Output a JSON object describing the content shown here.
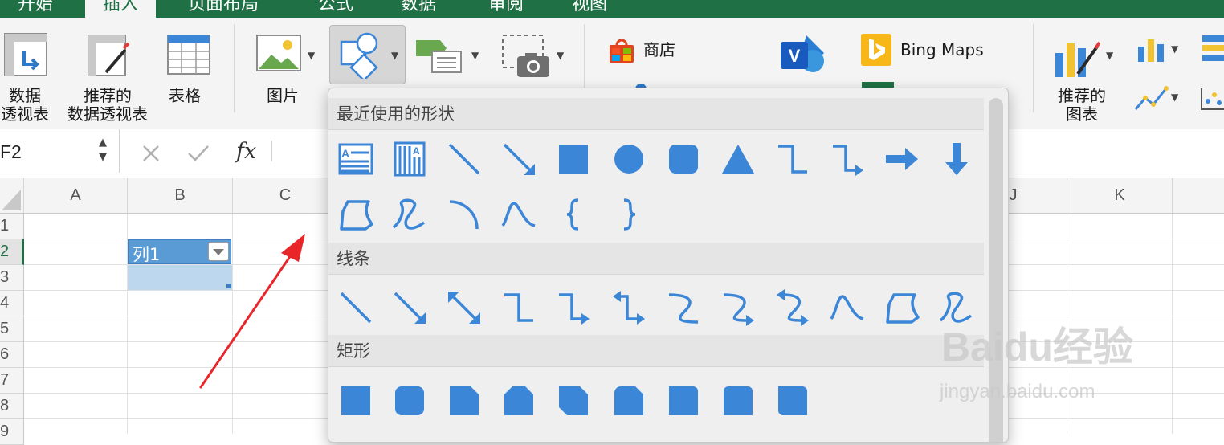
{
  "tabs": [
    "开始",
    "插入",
    "页面布局",
    "公式",
    "数据",
    "审阅",
    "视图"
  ],
  "active_tab": "插入",
  "ribbon": {
    "pivot_table": [
      "数据",
      "透视表"
    ],
    "recommended_pivot": [
      "推荐的",
      "数据透视表"
    ],
    "table": "表格",
    "picture": "图片",
    "store": "商店",
    "bing_maps": "Bing Maps",
    "recommended_charts": [
      "推荐的",
      "图表"
    ]
  },
  "formula_bar": {
    "name_box": "F2",
    "fx": "fx"
  },
  "grid": {
    "columns": [
      "A",
      "B",
      "C",
      "J",
      "K"
    ],
    "rows": [
      "1",
      "2",
      "3",
      "4",
      "5",
      "6",
      "7",
      "8",
      "9"
    ],
    "cell_b2": "列1"
  },
  "shapes_menu": {
    "recent_title": "最近使用的形状",
    "lines_title": "线条",
    "rect_title": "矩形",
    "recent_row1": [
      "text-box-icon",
      "vertical-text-box-icon",
      "line-icon",
      "arrow-line-icon",
      "rectangle-icon",
      "oval-icon",
      "rounded-rectangle-icon",
      "triangle-icon",
      "elbow-connector-icon",
      "elbow-arrow-connector-icon",
      "right-arrow-icon",
      "down-arrow-icon"
    ],
    "recent_row2": [
      "freeform-icon",
      "scribble-icon",
      "arc-icon",
      "curve-icon",
      "left-brace-icon",
      "right-brace-icon"
    ],
    "lines_row": [
      "line-icon",
      "arrow-line-icon",
      "double-arrow-line-icon",
      "elbow-connector-icon",
      "elbow-arrow-connector-icon",
      "elbow-double-arrow-connector-icon",
      "curved-connector-icon",
      "curved-arrow-connector-icon",
      "curved-double-arrow-connector-icon",
      "curve-icon",
      "freeform-icon",
      "scribble-icon"
    ],
    "rect_row": [
      "rectangle-icon",
      "rounded-rectangle-icon",
      "snip-single-corner-icon",
      "snip-same-side-icon",
      "snip-diagonal-icon",
      "snip-round-corner-icon",
      "round-single-corner-icon",
      "round-same-side-icon",
      "round-diagonal-icon"
    ]
  },
  "watermark": {
    "brand": "Baidu经验",
    "url": "jingyan.baidu.com"
  },
  "colors": {
    "accent_green": "#1f7145",
    "shape_blue": "#3c86d8",
    "annotation_red": "#e8262a"
  }
}
